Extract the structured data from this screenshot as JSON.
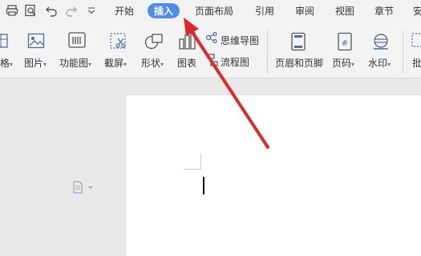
{
  "menu": {
    "tabs": [
      "开始",
      "插入",
      "页面布局",
      "引用",
      "审阅",
      "视图",
      "章节",
      "安"
    ],
    "active": "插入"
  },
  "ribbon": {
    "items": {
      "table": "格",
      "picture": "图片",
      "functional": "功能图",
      "screenshot": "截屏",
      "shape": "形状",
      "chart": "图表",
      "mindmap": "思维导图",
      "flowchart": "流程图",
      "header_footer": "页眉和页脚",
      "page_number": "页码",
      "watermark": "水印",
      "comment": "批"
    },
    "dropdown_glyph": "▾"
  },
  "colors": {
    "accent": "#4e8ee8",
    "annotation_arrow": "#d92b2b"
  },
  "icons": [
    "print-icon",
    "print-preview-icon",
    "undo-icon",
    "redo-icon",
    "more-icon",
    "doc-nav-icon"
  ]
}
